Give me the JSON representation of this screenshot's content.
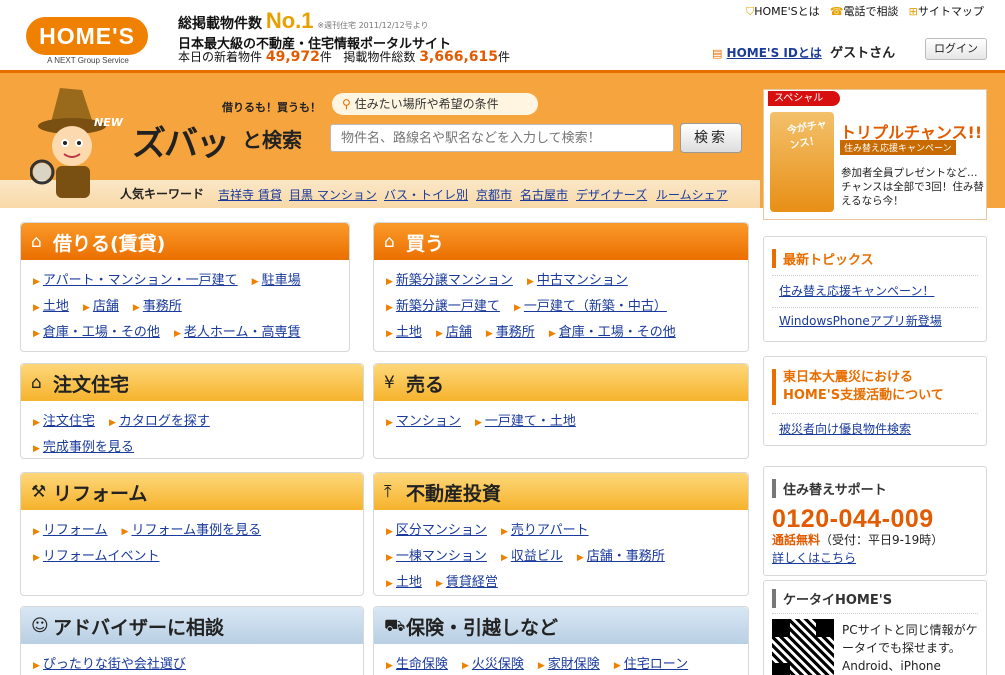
{
  "header": {
    "logo_text": "HOME'S",
    "logo_sub": "A NEXT Group Service",
    "tagline_prefix": "総掲載物件数",
    "tagline_no1": "No.1",
    "tagline_note": "※週刊住宅 2011/12/12号より",
    "portal_desc": "日本最大級の不動産・住宅情報ポータルサイト",
    "new_label": "本日の新着物件",
    "new_count": "49,972",
    "unit": "件",
    "total_label": "掲載物件総数",
    "total_count": "3,666,615",
    "links": [
      "HOME'Sとは",
      "電話で相談",
      "サイトマップ"
    ],
    "homes_id": "HOME'S IDとは",
    "guest": "ゲストさん",
    "login": "ログイン"
  },
  "banner": {
    "new": "NEW",
    "brand_small": "借りるも！買うも！",
    "brand_big": "ズバッ",
    "brand_kensaku": "と検索",
    "chip": "住みたい場所や希望の条件",
    "search_placeholder": "物件名、路線名や駅名などを入力して検索！",
    "search_button": "検索",
    "keywords_label": "人気キーワード",
    "keywords": [
      "吉祥寺 賃貸",
      "目黒 マンション",
      "バス・トイレ別",
      "京都市",
      "名古屋市",
      "デザイナーズ",
      "ルームシェア"
    ]
  },
  "special": {
    "tag": "スペシャル",
    "img_text": "今がチャンス！",
    "title": "トリプルチャンス!!",
    "subtitle": "住み替え応援キャンペーン",
    "body": "参加者全員プレゼントなど…チャンスは全部で3回！住み替えるなら今！"
  },
  "cards": {
    "rent": {
      "title": "借りる(賃貸)",
      "rows": [
        [
          "アパート・マンション・一戸建て",
          "駐車場"
        ],
        [
          "土地",
          "店舗",
          "事務所"
        ],
        [
          "倉庫・工場・その他",
          "老人ホーム・高専賃"
        ]
      ]
    },
    "buy": {
      "title": "買う",
      "rows": [
        [
          "新築分譲マンション",
          "中古マンション"
        ],
        [
          "新築分譲一戸建て",
          "一戸建て（新築・中古）"
        ],
        [
          "土地",
          "店舗",
          "事務所",
          "倉庫・工場・その他"
        ]
      ]
    },
    "order": {
      "title": "注文住宅",
      "rows": [
        [
          "注文住宅",
          "カタログを探す"
        ],
        [
          "完成事例を見る"
        ]
      ]
    },
    "sell": {
      "title": "売る",
      "rows": [
        [
          "マンション",
          "一戸建て・土地"
        ]
      ]
    },
    "reform": {
      "title": "リフォーム",
      "rows": [
        [
          "リフォーム",
          "リフォーム事例を見る"
        ],
        [
          "リフォームイベント"
        ]
      ]
    },
    "invest": {
      "title": "不動産投資",
      "rows": [
        [
          "区分マンション",
          "売りアパート"
        ],
        [
          "一棟マンション",
          "収益ビル",
          "店舗・事務所"
        ],
        [
          "土地",
          "賃貸経営"
        ]
      ]
    },
    "advisor": {
      "title": "アドバイザーに相談",
      "rows": [
        [
          "ぴったりな街や会社選び"
        ]
      ]
    },
    "insurance": {
      "title": "保険・引越しなど",
      "rows": [
        [
          "生命保険",
          "火災保険",
          "家財保険",
          "住宅ローン"
        ]
      ]
    }
  },
  "right": {
    "topics_title": "最新トピックス",
    "topics": [
      "住み替え応援キャンペーン！",
      "WindowsPhoneアプリ新登場"
    ],
    "quake_title": "東日本大震災における HOME'S支援活動について",
    "quake_link": "被災者向け優良物件検索",
    "support_title": "住み替えサポート",
    "phone": "0120-044-009",
    "free": "通話無料",
    "hours": "（受付：平日9-19時）",
    "details": "詳しくはこちら",
    "mobile_title": "ケータイHOME'S",
    "mobile_text": "PCサイトと同じ情報がケータイでも探せます。Android、iPhone"
  }
}
